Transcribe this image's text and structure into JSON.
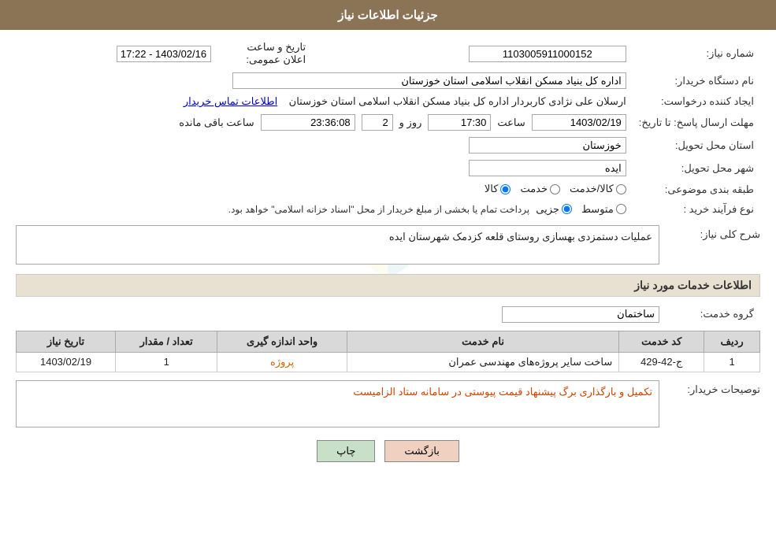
{
  "header": {
    "title": "جزئیات اطلاعات نیاز"
  },
  "fields": {
    "shomareNiaz_label": "شماره نیاز:",
    "shomareNiaz_value": "1103005911000152",
    "namDastgah_label": "نام دستگاه خریدار:",
    "namDastgah_value": "اداره کل بنیاد مسکن انقلاب اسلامی استان خوزستان",
    "ijadKonande_label": "ایجاد کننده درخواست:",
    "ijadKonande_value": "ارسلان علی نژادی کاربردار اداره کل بنیاد مسکن انقلاب اسلامی استان خوزستان",
    "ettelaatTamas_link": "اطلاعات تماس خریدار",
    "mohlat_label": "مهلت ارسال پاسخ: تا تاریخ:",
    "tarikhPasokh": "1403/02/19",
    "saatPasokh": "17:30",
    "rooz": "2",
    "saatBaqi": "23:36:08",
    "saatBaqiLabel": "ساعت باقی مانده",
    "ostan_label": "استان محل تحویل:",
    "ostan_value": "خوزستان",
    "shahr_label": "شهر محل تحویل:",
    "shahr_value": "ایده",
    "tabaqe_label": "طبقه بندی موضوعی:",
    "tabaqe_kala": "کالا",
    "tabaqe_khadamat": "خدمت",
    "tabaqe_kalaKhadamat": "کالا/خدمت",
    "noeFarayand_label": "نوع فرآیند خرید :",
    "noeFarayand_jozii": "جزیی",
    "noeFarayand_mottavasset": "متوسط",
    "noeFarayand_note": "پرداخت تمام یا بخشی از مبلغ خریدار از محل \"اسناد خزانه اسلامی\" خواهد بود.",
    "tarikhAelan_label": "تاریخ و ساعت اعلان عمومی:",
    "tarikhAelan_value": "1403/02/16 - 17:22",
    "sharhKolliNiaz_label": "شرح کلی نیاز:",
    "sharhKolliNiaz_value": "عملیات دستمزدی بهسازی روستای قلعه کزدمک شهرستان ایده",
    "ettelaatKhadamat_label": "اطلاعات خدمات مورد نیاز",
    "grohKhadamat_label": "گروه خدمت:",
    "grohKhadamat_value": "ساختمان",
    "table": {
      "headers": [
        "ردیف",
        "کد خدمت",
        "نام خدمت",
        "واحد اندازه گیری",
        "تعداد / مقدار",
        "تاریخ نیاز"
      ],
      "rows": [
        {
          "radif": "1",
          "kodKhadamat": "ج-42-429",
          "namKhadamat": "ساخت سایر پروژه‌های مهندسی عمران",
          "vahed": "پروژه",
          "tedad": "1",
          "tarikh": "1403/02/19"
        }
      ]
    },
    "tosifKharidar_label": "توصیحات خریدار:",
    "tosifKharidar_value": "تکمیل و بارگذاری برگ پیشنهاد قیمت پیوستی در سامانه ستاد الزامیست",
    "btn_print": "چاپ",
    "btn_back": "بازگشت"
  }
}
